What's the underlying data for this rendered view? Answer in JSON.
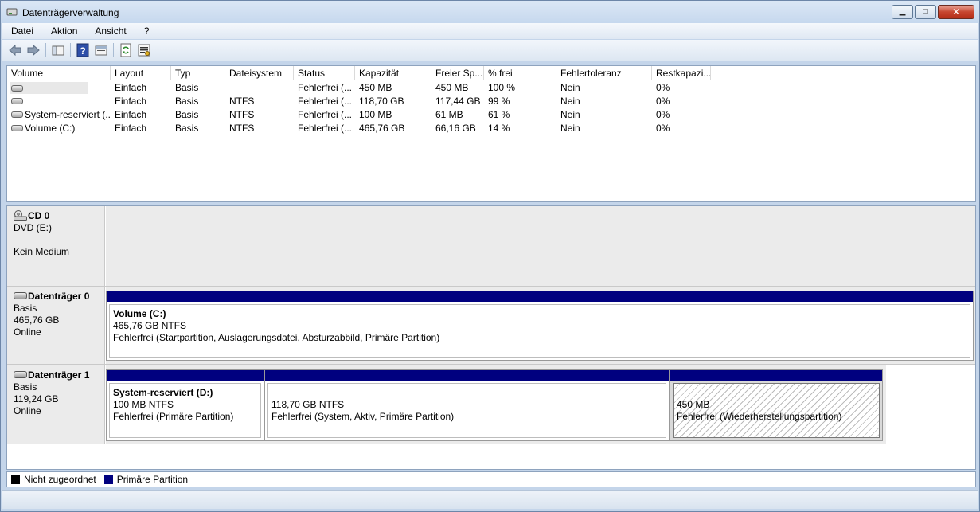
{
  "window": {
    "title": "Datenträgerverwaltung",
    "buttons": {
      "minimize": "▁",
      "maximize": "□",
      "close": "✕"
    }
  },
  "menu": {
    "items": [
      "Datei",
      "Aktion",
      "Ansicht",
      "?"
    ]
  },
  "toolbar": {
    "icons": [
      "back-arrow-icon",
      "forward-arrow-icon",
      "console-tree-icon",
      "help-icon",
      "properties-icon",
      "refresh-icon",
      "export-icon"
    ]
  },
  "volume_list": {
    "columns": [
      "Volume",
      "Layout",
      "Typ",
      "Dateisystem",
      "Status",
      "Kapazität",
      "Freier Sp...",
      "% frei",
      "Fehlertoleranz",
      "Restkapazi..."
    ],
    "rows": [
      {
        "volume": "",
        "layout": "Einfach",
        "typ": "Basis",
        "fs": "",
        "status": "Fehlerfrei (...",
        "cap": "450 MB",
        "free": "450 MB",
        "pct": "100 %",
        "ft": "Nein",
        "over": "0%"
      },
      {
        "volume": "",
        "layout": "Einfach",
        "typ": "Basis",
        "fs": "NTFS",
        "status": "Fehlerfrei (...",
        "cap": "118,70 GB",
        "free": "117,44 GB",
        "pct": "99 %",
        "ft": "Nein",
        "over": "0%"
      },
      {
        "volume": "System-reserviert (...",
        "layout": "Einfach",
        "typ": "Basis",
        "fs": "NTFS",
        "status": "Fehlerfrei (...",
        "cap": "100 MB",
        "free": "61 MB",
        "pct": "61 %",
        "ft": "Nein",
        "over": "0%"
      },
      {
        "volume": "Volume (C:)",
        "layout": "Einfach",
        "typ": "Basis",
        "fs": "NTFS",
        "status": "Fehlerfrei (...",
        "cap": "465,76 GB",
        "free": "66,16 GB",
        "pct": "14 %",
        "ft": "Nein",
        "over": "0%"
      }
    ]
  },
  "disks": {
    "cd0": {
      "name": "CD 0",
      "line1": "DVD (E:)",
      "line3": "Kein Medium"
    },
    "disk0": {
      "name": "Datenträger 0",
      "type": "Basis",
      "size": "465,76 GB",
      "state": "Online",
      "partitions": [
        {
          "name": "Volume  (C:)",
          "size": "465,76 GB NTFS",
          "status": "Fehlerfrei (Startpartition, Auslagerungsdatei, Absturzabbild, Primäre Partition)"
        }
      ]
    },
    "disk1": {
      "name": "Datenträger 1",
      "type": "Basis",
      "size": "119,24 GB",
      "state": "Online",
      "partitions": [
        {
          "name": "System-reserviert  (D:)",
          "size": "100 MB NTFS",
          "status": "Fehlerfrei (Primäre Partition)"
        },
        {
          "name": "",
          "size": "118,70 GB NTFS",
          "status": "Fehlerfrei (System, Aktiv, Primäre Partition)"
        },
        {
          "name": "",
          "size": "450 MB",
          "status": "Fehlerfrei (Wiederherstellungspartition)"
        }
      ]
    }
  },
  "legend": {
    "items": [
      {
        "label": "Nicht zugeordnet",
        "color": "#000000"
      },
      {
        "label": "Primäre Partition",
        "color": "#00007f"
      }
    ]
  }
}
